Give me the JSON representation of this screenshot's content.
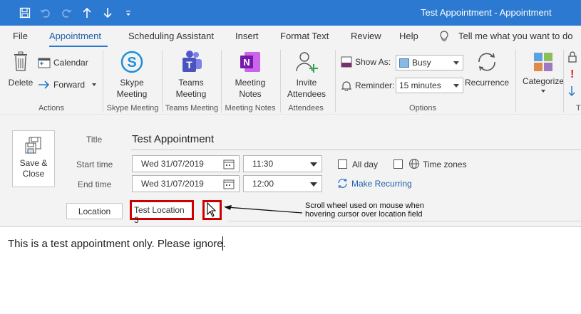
{
  "window": {
    "title": "Test Appointment  -  Appointment"
  },
  "quick_access": {
    "icons": [
      "save-icon",
      "undo-icon",
      "redo-icon",
      "up-arrow-icon",
      "down-arrow-icon",
      "customize-icon"
    ]
  },
  "menu": {
    "items": [
      "File",
      "Appointment",
      "Scheduling Assistant",
      "Insert",
      "Format Text",
      "Review",
      "Help"
    ],
    "tell_me": "Tell me what you want to do"
  },
  "ribbon": {
    "actions": {
      "delete": "Delete",
      "calendar": "Calendar",
      "forward": "Forward",
      "group": "Actions"
    },
    "skype": {
      "label_line1": "Skype",
      "label_line2": "Meeting",
      "group": "Skype Meeting"
    },
    "teams": {
      "label_line1": "Teams",
      "label_line2": "Meeting",
      "group": "Teams Meeting"
    },
    "notes": {
      "label_line1": "Meeting",
      "label_line2": "Notes",
      "group": "Meeting Notes"
    },
    "attendees": {
      "label_line1": "Invite",
      "label_line2": "Attendees",
      "group": "Attendees"
    },
    "options": {
      "show_as_label": "Show As:",
      "show_as_value": "Busy",
      "reminder_label": "Reminder:",
      "reminder_value": "15 minutes",
      "recurrence": "Recurrence",
      "group": "Options"
    },
    "categorize": {
      "label": "Categorize"
    },
    "tags": {
      "group_partial": "T"
    }
  },
  "form": {
    "save_close_line1": "Save &",
    "save_close_line2": "Close",
    "title_label": "Title",
    "title_value": "Test Appointment",
    "start_label": "Start time",
    "start_date": "Wed 31/07/2019",
    "start_time": "11:30",
    "end_label": "End time",
    "end_date": "Wed 31/07/2019",
    "end_time": "12:00",
    "all_day": "All day",
    "time_zones": "Time zones",
    "make_recurring": "Make Recurring",
    "location_label": "Location",
    "location_value": "Test Location 3"
  },
  "body": {
    "text": "This is a test appointment only. Please ignore."
  },
  "annotation": {
    "line1": "Scroll wheel used on mouse when",
    "line2": "hovering cursor over location field"
  },
  "colors": {
    "titlebar": "#2b79d0",
    "highlight_box": "#cc0000",
    "link": "#1f5fae"
  }
}
